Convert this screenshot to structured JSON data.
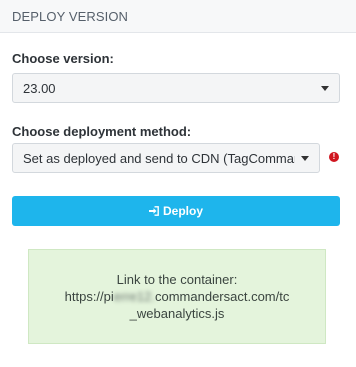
{
  "panel": {
    "title": "DEPLOY VERSION"
  },
  "version": {
    "label": "Choose version:",
    "selected": "23.00"
  },
  "method": {
    "label": "Choose deployment method:",
    "selected": "Set as deployed and send to CDN (TagCommander CDN)",
    "warning_icon": "exclamation-circle-icon"
  },
  "deploy": {
    "label": "Deploy",
    "icon": "sign-in-icon"
  },
  "link": {
    "label": "Link to the container:",
    "url_prefix": "https://pi",
    "url_hidden": "erre12.",
    "url_middle": "commandersact.com/tc",
    "url_suffix": "_webanalytics.js"
  },
  "colors": {
    "accent": "#1eb5ec",
    "warning": "#d0151f",
    "success_bg": "#e4f4dc"
  }
}
